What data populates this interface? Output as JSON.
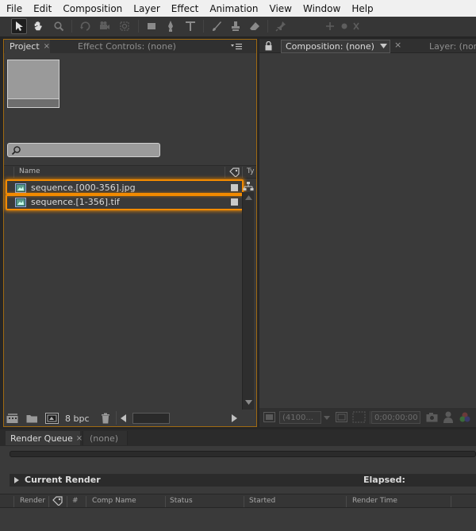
{
  "menu": [
    "File",
    "Edit",
    "Composition",
    "Layer",
    "Effect",
    "Animation",
    "View",
    "Window",
    "Help"
  ],
  "toolbar": {
    "tools": [
      "selection-tool",
      "hand-tool",
      "zoom-tool",
      "rotate-tool",
      "camera-tool",
      "pan-behind-tool",
      "rectangle-tool",
      "pen-tool",
      "type-tool",
      "brush-tool",
      "clone-stamp-tool",
      "eraser-tool",
      "puppet-pin-tool"
    ]
  },
  "project_panel": {
    "tab_project": "Project",
    "tab_effect_controls": "Effect Controls: (none)",
    "column_name": "Name",
    "column_type": "Ty",
    "files": [
      {
        "name": "sequence.[000-356].jpg"
      },
      {
        "name": "sequence.[1-356].tif"
      }
    ],
    "bit_depth": "8 bpc"
  },
  "comp_panel": {
    "tab_composition": "Composition: (none)",
    "tab_layer": "Layer: (non",
    "zoom": "(4100...",
    "timecode": "0;00;00;00"
  },
  "render_queue": {
    "tab_label": "Render Queue",
    "tab_none": "(none)",
    "current_render": "Current Render",
    "elapsed": "Elapsed:",
    "columns": [
      "Render",
      "#",
      "Comp Name",
      "Status",
      "Started",
      "Render Time"
    ]
  },
  "colors": {
    "highlight": "#f28a00",
    "panel_border_active": "#a06a12",
    "panel_bg": "#3a3a3a"
  }
}
